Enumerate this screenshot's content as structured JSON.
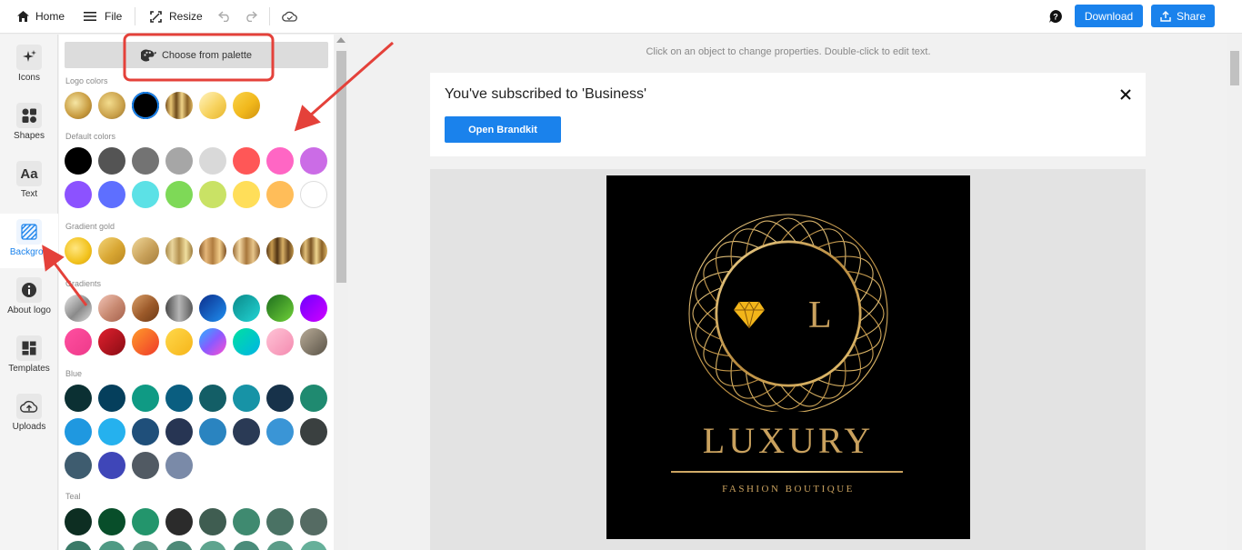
{
  "topbar": {
    "home": "Home",
    "file": "File",
    "resize": "Resize",
    "download": "Download",
    "share": "Share"
  },
  "rail": [
    {
      "label": "Icons",
      "icon": "sparkle-icon"
    },
    {
      "label": "Shapes",
      "icon": "shapes-icon"
    },
    {
      "label": "Text",
      "icon": "text-icon"
    },
    {
      "label": "Backgrou",
      "icon": "background-icon",
      "active": true
    },
    {
      "label": "About logo",
      "icon": "info-icon"
    },
    {
      "label": "Templates",
      "icon": "templates-icon"
    },
    {
      "label": "Uploads",
      "icon": "upload-icon"
    }
  ],
  "panel": {
    "palette_button": "Choose from palette",
    "sections": {
      "logo": "Logo colors",
      "default": "Default colors",
      "gradient_gold": "Gradient gold",
      "gradients": "Gradients",
      "blue": "Blue",
      "teal": "Teal"
    },
    "colors": {
      "logo": [
        "gold1",
        "gold2",
        "#000000",
        "goldstripe",
        "gold3",
        "gold4"
      ],
      "default": [
        "#000000",
        "#545454",
        "#737373",
        "#a6a6a6",
        "#d9d9d9",
        "#ff5757",
        "#ff66c4",
        "#cb6ce6",
        "#8c52ff",
        "#5e6fff",
        "#5ce1e6",
        "#7ed957",
        "#c9e265",
        "#ffde59",
        "#ffbd59",
        "#ffffff"
      ],
      "blue": [
        "#0b3033",
        "#053f5c",
        "#0f9a84",
        "#0a5e80",
        "#135e66",
        "#1793a6",
        "#17324a",
        "#1f8a70",
        "#1f98e0",
        "#25b1ee",
        "#1f4f7a",
        "#273553",
        "#2a84c0",
        "#2a3a55",
        "#3a95d6",
        "#3a4040",
        "#3e5c6f",
        "#3f46b8",
        "#515a63",
        "#7a8aa8"
      ],
      "teal": [
        "#0d2e22",
        "#084e2a",
        "#23956c",
        "#2b2b2b",
        "#3f5d51",
        "#3f8a70",
        "#4a7264",
        "#556b63"
      ]
    }
  },
  "canvas": {
    "hint": "Click on an object to change properties. Double-click to edit text.",
    "notice_title": "You've subscribed to 'Business'",
    "notice_button": "Open Brandkit",
    "logo_letter": "L",
    "wordmark": "LUXURY",
    "tagline": "FASHION BOUTIQUE",
    "gold": "#c9a15e"
  }
}
